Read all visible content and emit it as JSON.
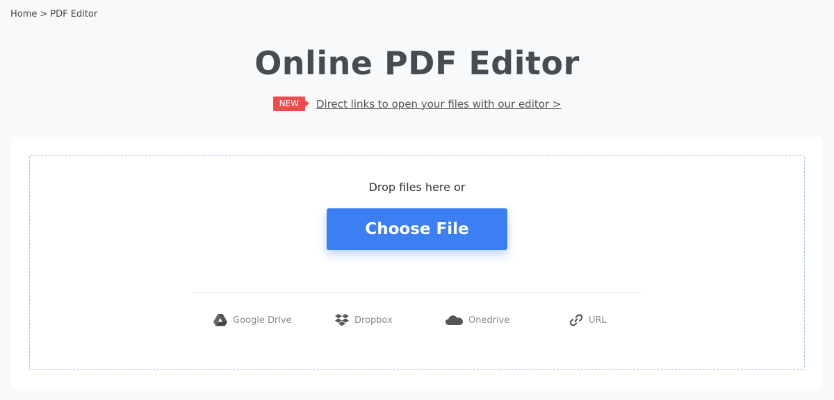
{
  "breadcrumb": {
    "home": "Home",
    "separator": ">",
    "current": "PDF Editor"
  },
  "title": "Online PDF Editor",
  "promo": {
    "badge": "NEW",
    "link_text": "Direct links to open your files with our editor >"
  },
  "upload": {
    "drop_text": "Drop files here or",
    "button_label": "Choose File"
  },
  "sources": [
    {
      "label": "Google Drive",
      "icon": "google-drive-icon"
    },
    {
      "label": "Dropbox",
      "icon": "dropbox-icon"
    },
    {
      "label": "Onedrive",
      "icon": "onedrive-icon"
    },
    {
      "label": "URL",
      "icon": "link-icon"
    }
  ],
  "colors": {
    "accent": "#3b7ff2",
    "badge": "#f04c4c",
    "title": "#454c52",
    "dropzone_border": "#9cc0e8"
  }
}
